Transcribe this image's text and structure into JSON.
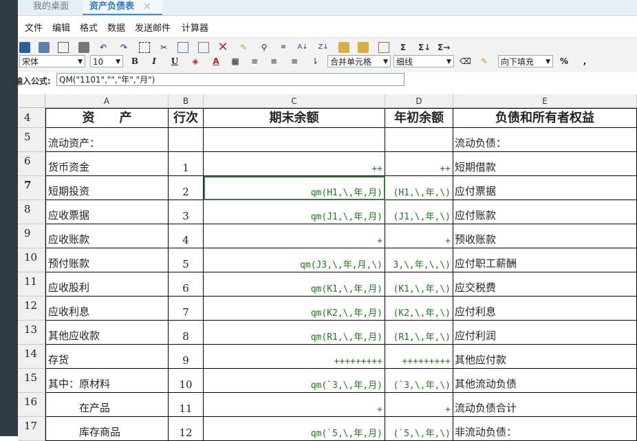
{
  "tabs": {
    "home": "我的桌面",
    "active": "资产负债表",
    "close": "✕"
  },
  "menu": [
    "文件",
    "编辑",
    "格式",
    "数据",
    "发送邮件",
    "计算器"
  ],
  "toolbar_icons": [
    "save-icon",
    "save-as-icon",
    "print-preview-icon",
    "print-icon",
    "undo-icon",
    "redo-icon",
    "select-all-icon",
    "cut-icon",
    "copy-icon",
    "paste-icon",
    "delete-icon",
    "format-brush-icon",
    "find-icon",
    "replace-icon",
    "sort-asc-icon",
    "sort-desc-icon",
    "lock-icon",
    "unlock-icon",
    "page-icon",
    "sum-icon",
    "sum-row-icon",
    "sum-col-icon"
  ],
  "format": {
    "font": "宋体",
    "size": "10",
    "bold": "B",
    "italic": "I",
    "underline": "U",
    "merge": "合并单元格",
    "border": "细线",
    "fill": "向下填充",
    "percent": "%",
    "comma": ","
  },
  "formula": {
    "label": "输入公式:",
    "value": "QM(\"1101\",\"\",\"年\",\"月\")"
  },
  "columns": [
    "A",
    "B",
    "C",
    "D",
    "E"
  ],
  "header_row": {
    "num": "4",
    "a": "资　　产",
    "b": "行次",
    "c": "期末余额",
    "d": "年初余额",
    "e": "负债和所有者权益"
  },
  "rows": [
    {
      "num": "5",
      "a": "流动资产：",
      "b": "",
      "c": "",
      "d": "",
      "e": "流动负债："
    },
    {
      "num": "6",
      "a": "货币资金",
      "b": "1",
      "c": "++",
      "d": "++",
      "e": "短期借款"
    },
    {
      "num": "7",
      "a": "短期投资",
      "b": "2",
      "c": "qm(H1,\\,年,月)",
      "d": "(H1,\\,年,\\)",
      "e": "应付票据"
    },
    {
      "num": "8",
      "a": "应收票据",
      "b": "3",
      "c": "qm(J1,\\,年,月)",
      "d": "(J1,\\,年,\\)",
      "e": "应付账款"
    },
    {
      "num": "9",
      "a": "应收账款",
      "b": "4",
      "c": "+",
      "d": "+",
      "e": "预收账款"
    },
    {
      "num": "10",
      "a": "预付账款",
      "b": "5",
      "c": "qm(J3,\\,年,月,\\)",
      "d": "3,\\,年,\\,\\)",
      "e": "应付职工薪酬"
    },
    {
      "num": "11",
      "a": "应收股利",
      "b": "6",
      "c": "qm(K1,\\,年,月)",
      "d": "(K1,\\,年,\\)",
      "e": "应交税费"
    },
    {
      "num": "12",
      "a": "应收利息",
      "b": "7",
      "c": "qm(K2,\\,年,月)",
      "d": "(K2,\\,年,\\)",
      "e": "应付利息"
    },
    {
      "num": "13",
      "a": "其他应收款",
      "b": "8",
      "c": "qm(R1,\\,年,月)",
      "d": "(R1,\\,年,\\)",
      "e": "应付利润"
    },
    {
      "num": "14",
      "a": "存货",
      "b": "9",
      "c": "+++++++++",
      "d": "+++++++++",
      "e": "其他应付款"
    },
    {
      "num": "15",
      "a": "其中：原材料",
      "b": "10",
      "c": "qm(`3,\\,年,月)",
      "d": "(`3,\\,年,\\)",
      "e": "其他流动负债"
    },
    {
      "num": "16",
      "a": "　　　在产品",
      "b": "11",
      "c": "+",
      "d": "+",
      "e": "流动负债合计"
    },
    {
      "num": "17",
      "a": "　　　库存商品",
      "b": "12",
      "c": "qm(`5,\\,年,月)",
      "d": "(`5,\\,年,\\)",
      "e": "非流动负债："
    }
  ]
}
